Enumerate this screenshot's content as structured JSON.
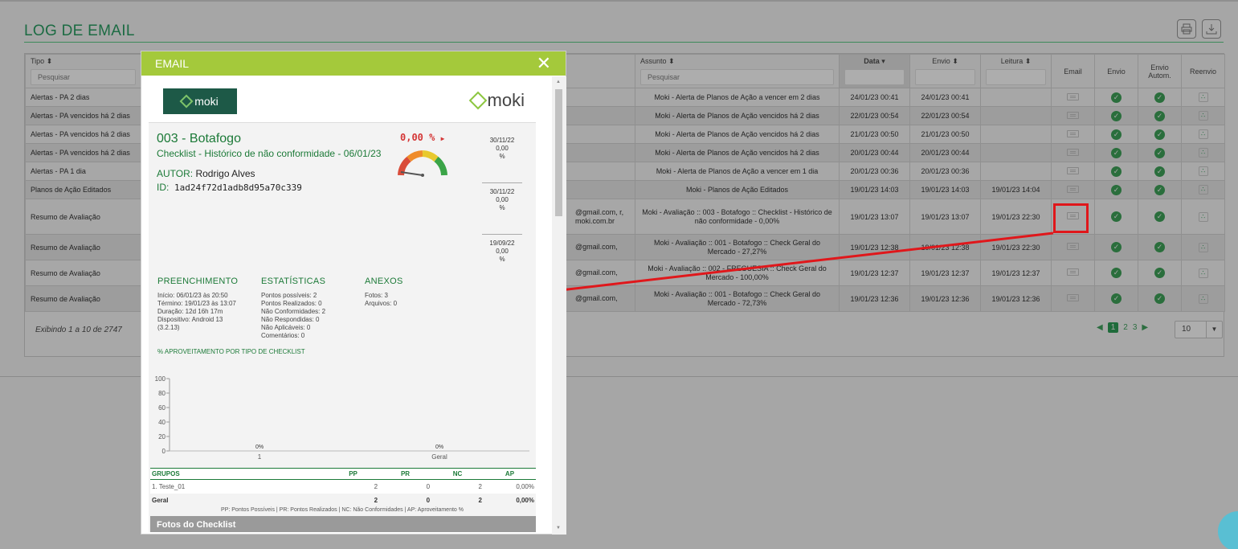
{
  "page": {
    "title": "LOG DE EMAIL"
  },
  "table": {
    "headers": {
      "tipo": "Tipo ⬍",
      "assunto": "Assunto ⬍",
      "data": "Data ▾",
      "envio": "Envio ⬍",
      "leitura": "Leitura ⬍",
      "email": "Email",
      "envio_flag": "Envio",
      "envio_autom": "Envio Autom.",
      "reenvio": "Reenvio"
    },
    "filter_placeholder": "Pesquisar",
    "rows": [
      {
        "tipo": "Alertas - PA 2 dias",
        "dest": "",
        "assunto": "Moki - Alerta de Planos de Ação a vencer em 2 dias",
        "data": "24/01/23 00:41",
        "envio": "24/01/23 00:41",
        "leitura": ""
      },
      {
        "tipo": "Alertas - PA vencidos há 2 dias",
        "dest": "",
        "assunto": "Moki - Alerta de Planos de Ação vencidos há 2 dias",
        "data": "22/01/23 00:54",
        "envio": "22/01/23 00:54",
        "leitura": ""
      },
      {
        "tipo": "Alertas - PA vencidos há 2 dias",
        "dest": "",
        "assunto": "Moki - Alerta de Planos de Ação vencidos há 2 dias",
        "data": "21/01/23 00:50",
        "envio": "21/01/23 00:50",
        "leitura": ""
      },
      {
        "tipo": "Alertas - PA vencidos há 2 dias",
        "dest": "",
        "assunto": "Moki - Alerta de Planos de Ação vencidos há 2 dias",
        "data": "20/01/23 00:44",
        "envio": "20/01/23 00:44",
        "leitura": ""
      },
      {
        "tipo": "Alertas - PA 1 dia",
        "dest": "",
        "assunto": "Moki - Alerta de Planos de Ação a vencer em 1 dia",
        "data": "20/01/23 00:36",
        "envio": "20/01/23 00:36",
        "leitura": ""
      },
      {
        "tipo": "Planos de Ação Editados",
        "dest": "",
        "assunto": "Moki - Planos de Ação Editados",
        "data": "19/01/23 14:03",
        "envio": "19/01/23 14:03",
        "leitura": "19/01/23 14:04"
      },
      {
        "tipo": "Resumo de Avaliação",
        "dest": "@gmail.com, r, moki.com.br",
        "assunto": "Moki - Avaliação :: 003 - Botafogo :: Checklist - Histórico de não conformidade - 0,00%",
        "data": "19/01/23 13:07",
        "envio": "19/01/23 13:07",
        "leitura": "19/01/23 22:30"
      },
      {
        "tipo": "Resumo de Avaliação",
        "dest": "@gmail.com,",
        "assunto": "Moki - Avaliação :: 001 - Botafogo :: Check Geral do Mercado - 27,27%",
        "data": "19/01/23 12:38",
        "envio": "19/01/23 12:38",
        "leitura": "19/01/23 22:30"
      },
      {
        "tipo": "Resumo de Avaliação",
        "dest": "@gmail.com,",
        "assunto": "Moki - Avaliação :: 002 - FREGUESIA :: Check Geral do Mercado - 100,00%",
        "data": "19/01/23 12:37",
        "envio": "19/01/23 12:37",
        "leitura": "19/01/23 12:37"
      },
      {
        "tipo": "Resumo de Avaliação",
        "dest": "@gmail.com,",
        "assunto": "Moki - Avaliação :: 001 - Botafogo :: Check Geral do Mercado - 72,73%",
        "data": "19/01/23 12:36",
        "envio": "19/01/23 12:36",
        "leitura": "19/01/23 12:36"
      }
    ],
    "summary": "Exibindo 1 a 10 de 2747",
    "pagination": {
      "pages": [
        "1",
        "2",
        "3"
      ],
      "active": "1",
      "per_page": "10"
    }
  },
  "modal": {
    "title": "EMAIL",
    "brand": "moki",
    "store": "003 - Botafogo",
    "checklist": "Checklist - Histórico de não conformidade - 06/01/23",
    "autor_label": "AUTOR:",
    "autor": "Rodrigo Alves",
    "id_label": "ID:",
    "id": "1ad24f72d1adb8d95a70c339",
    "score": "0,00 %",
    "history": [
      {
        "date": "30/11/22",
        "value": "0,00",
        "unit": "%"
      },
      {
        "date": "30/11/22",
        "value": "0,00",
        "unit": "%"
      },
      {
        "date": "19/09/22",
        "value": "0,00",
        "unit": "%"
      }
    ],
    "preenchimento": {
      "title": "PREENCHIMENTO",
      "lines": [
        "Início: 06/01/23 às 20:50",
        "Término: 19/01/23 às 13:07",
        "Duração: 12d 16h 17m",
        "Dispositivo: Android 13",
        "(3.2.13)"
      ]
    },
    "estatisticas": {
      "title": "ESTATÍSTICAS",
      "lines": [
        "Pontos possíveis: 2",
        "Pontos Realizados: 0",
        "Não Conformidades: 2",
        "Não Respondidas:  0",
        "Não Aplicáveis:  0",
        "Comentários:  0"
      ]
    },
    "anexos": {
      "title": "ANEXOS",
      "lines": [
        "Fotos: 3",
        "Arquivos: 0"
      ]
    },
    "aproveitamento_title": "% APROVEITAMENTO POR TIPO DE CHECKLIST",
    "groups_table": {
      "headers": [
        "GRUPOS",
        "PP",
        "PR",
        "NC",
        "AP"
      ],
      "rows": [
        [
          "1. Teste_01",
          "2",
          "0",
          "2",
          "0,00%"
        ]
      ],
      "total": [
        "Geral",
        "2",
        "0",
        "2",
        "0,00%"
      ]
    },
    "legend_note": "PP: Pontos Possíveis | PR: Pontos Realizados | NC: Não Conformidades | AP: Aproveitamento %",
    "fotos_title": "Fotos do Checklist"
  },
  "chart_data": {
    "type": "bar",
    "categories": [
      "1",
      "Geral"
    ],
    "values": [
      0,
      0
    ],
    "data_labels": [
      "0%",
      "0%"
    ],
    "ylim": [
      0,
      100
    ],
    "yticks": [
      0,
      20,
      40,
      60,
      80,
      100
    ],
    "title": "",
    "xlabel": "",
    "ylabel": ""
  },
  "colors": {
    "accent": "#a4c93b",
    "brand_green": "#1c7a38",
    "alert": "#e0171b"
  }
}
